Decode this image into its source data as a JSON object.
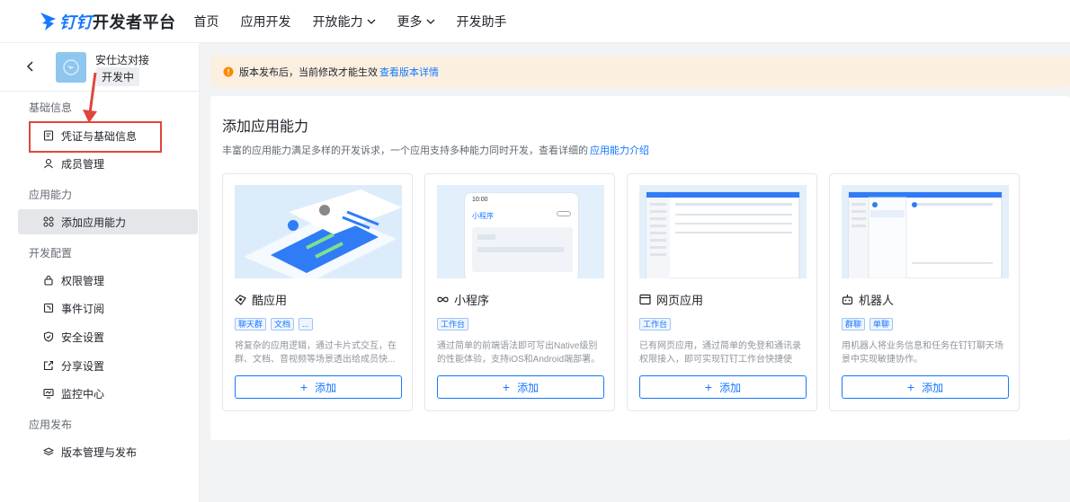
{
  "header": {
    "logo_brand": "钉钉",
    "logo_suffix": "开发者平台",
    "nav": [
      {
        "label": "首页"
      },
      {
        "label": "应用开发"
      },
      {
        "label": "开放能力"
      },
      {
        "label": "更多"
      },
      {
        "label": "开发助手"
      }
    ]
  },
  "sidebar": {
    "app_name": "安仕达对接",
    "app_status": "开发中",
    "sections": [
      {
        "title": "基础信息",
        "items": [
          {
            "label": "凭证与基础信息",
            "icon": "credential-icon"
          },
          {
            "label": "成员管理",
            "icon": "member-icon"
          }
        ]
      },
      {
        "title": "应用能力",
        "items": [
          {
            "label": "添加应用能力",
            "icon": "apps-icon"
          }
        ]
      },
      {
        "title": "开发配置",
        "items": [
          {
            "label": "权限管理",
            "icon": "lock-icon"
          },
          {
            "label": "事件订阅",
            "icon": "event-icon"
          },
          {
            "label": "安全设置",
            "icon": "shield-icon"
          },
          {
            "label": "分享设置",
            "icon": "share-icon"
          },
          {
            "label": "监控中心",
            "icon": "monitor-icon"
          }
        ]
      },
      {
        "title": "应用发布",
        "items": [
          {
            "label": "版本管理与发布",
            "icon": "layers-icon"
          }
        ]
      }
    ]
  },
  "notice": {
    "text": "版本发布后，当前修改才能生效",
    "link": "查看版本详情"
  },
  "panel": {
    "title": "添加应用能力",
    "desc": "丰富的应用能力满足多样的开发诉求，一个应用支持多种能力同时开发，查看详细的",
    "desc_link": "应用能力介绍",
    "add_label": "添加",
    "cards": [
      {
        "title": "酷应用",
        "icon": "cool-app-icon",
        "tags": [
          "聊天群",
          "文档",
          "..."
        ],
        "desc": "将复杂的应用逻辑，通过卡片式交互，在群、文档、音视频等场景透出给成员快..."
      },
      {
        "title": "小程序",
        "icon": "miniprogram-icon",
        "tags": [
          "工作台"
        ],
        "desc": "通过简单的前端语法即可写出Native级别的性能体验，支持iOS和Android端部署。",
        "preview_title": "小程序",
        "preview_time": "10:00"
      },
      {
        "title": "网页应用",
        "icon": "webpage-icon",
        "tags": [
          "工作台"
        ],
        "desc": "已有网页应用，通过简单的免登和通讯录权限接入，即可实现钉钉工作台快捷使用。"
      },
      {
        "title": "机器人",
        "icon": "robot-icon",
        "tags": [
          "群聊",
          "单聊"
        ],
        "desc": "用机器人将业务信息和任务在钉钉聊天场景中实现敏捷协作。"
      }
    ]
  },
  "colors": {
    "accent": "#1677ff",
    "notice_bg": "#fbf0e0",
    "highlight": "#e0463c"
  }
}
